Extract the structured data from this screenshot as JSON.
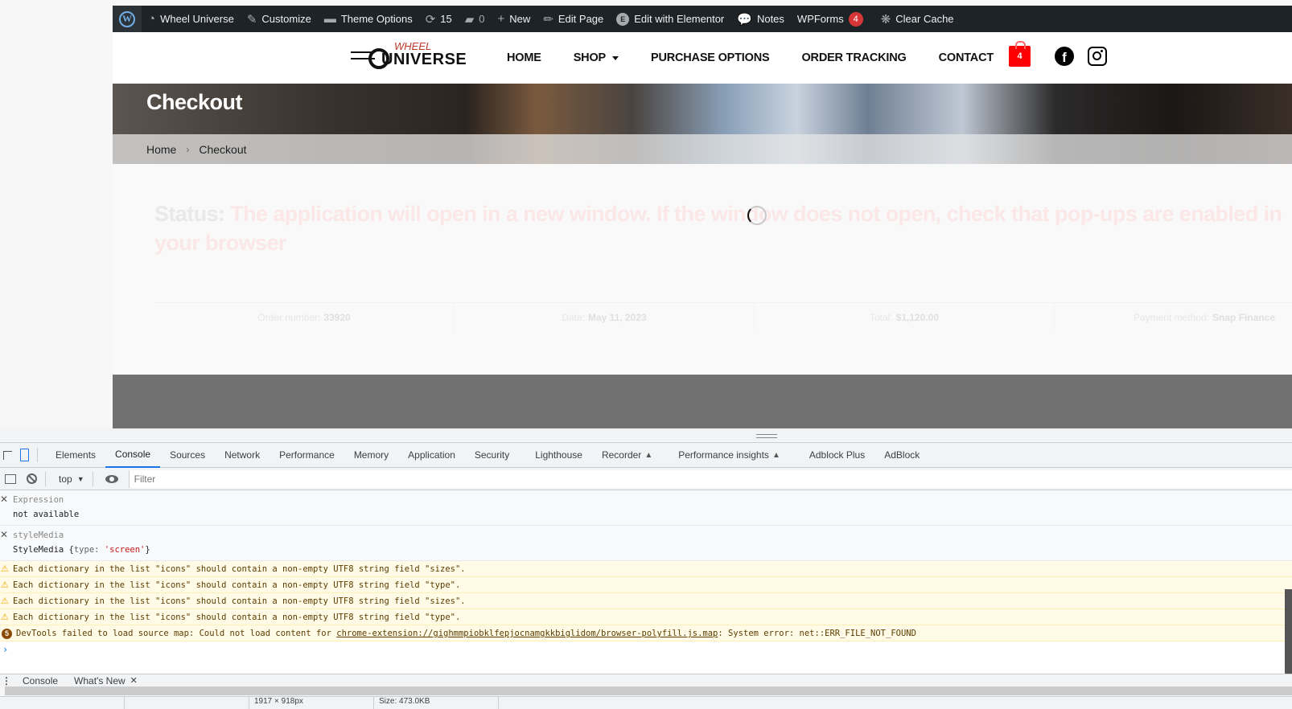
{
  "adminbar": {
    "site_name": "Wheel Universe",
    "customize": "Customize",
    "theme_options": "Theme Options",
    "updates_count": "15",
    "comments_count": "0",
    "new": "New",
    "edit_page": "Edit Page",
    "edit_elementor": "Edit with Elementor",
    "notes": "Notes",
    "wpforms": "WPForms",
    "wpforms_badge": "4",
    "clear_cache": "Clear Cache"
  },
  "site": {
    "logo_top": "WHEEL",
    "logo_bottom": "UNIVERSE",
    "nav": [
      "HOME",
      "SHOP",
      "PURCHASE OPTIONS",
      "ORDER TRACKING",
      "CONTACT"
    ],
    "cart_count": "4",
    "brand_color": "#ff0000"
  },
  "hero": {
    "title": "Checkout",
    "breadcrumb": [
      "Home",
      "Checkout"
    ],
    "breadcrumb_sep": "›"
  },
  "content": {
    "status_label": "Status:",
    "status_message": "The application will open in a new window. If the window does not open, check that pop-ups are enabled in your browser",
    "order": [
      {
        "label": "Order number:",
        "value": "33920"
      },
      {
        "label": "Date:",
        "value": "May 11, 2023"
      },
      {
        "label": "Total:",
        "value": "$1,120.00"
      },
      {
        "label": "Payment method:",
        "value": "Snap Finance"
      }
    ]
  },
  "devtools": {
    "tabs": [
      "Elements",
      "Console",
      "Sources",
      "Network",
      "Performance",
      "Memory",
      "Application",
      "Security",
      "Lighthouse",
      "Recorder",
      "Performance insights",
      "Adblock Plus",
      "AdBlock"
    ],
    "active_tab": "Console",
    "context": "top",
    "filter_placeholder": "Filter",
    "expressions": [
      {
        "name": "Expression",
        "value": "not available"
      },
      {
        "name": "styleMedia",
        "value_prefix": "StyleMedia {",
        "value_key": "type: ",
        "value_str": "'screen'",
        "value_suffix": "}"
      }
    ],
    "warnings": [
      "Each dictionary in the list \"icons\" should contain a non-empty UTF8 string field \"sizes\".",
      "Each dictionary in the list \"icons\" should contain a non-empty UTF8 string field \"type\".",
      "Each dictionary in the list \"icons\" should contain a non-empty UTF8 string field \"sizes\".",
      "Each dictionary in the list \"icons\" should contain a non-empty UTF8 string field \"type\"."
    ],
    "error": {
      "count": "5",
      "prefix": "DevTools failed to load source map: Could not load content for ",
      "link": "chrome-extension://gighmmpiobklfepjocnamgkkbiglidom/browser-polyfill.js.map",
      "suffix": ": System error: net::ERR_FILE_NOT_FOUND"
    },
    "prompt": "›",
    "drawer_tabs": [
      "Console",
      "What's New"
    ],
    "drawer_close": "✕",
    "statusbar": [
      "",
      "",
      "1917 × 918px",
      "Size: 473.0KB"
    ]
  }
}
